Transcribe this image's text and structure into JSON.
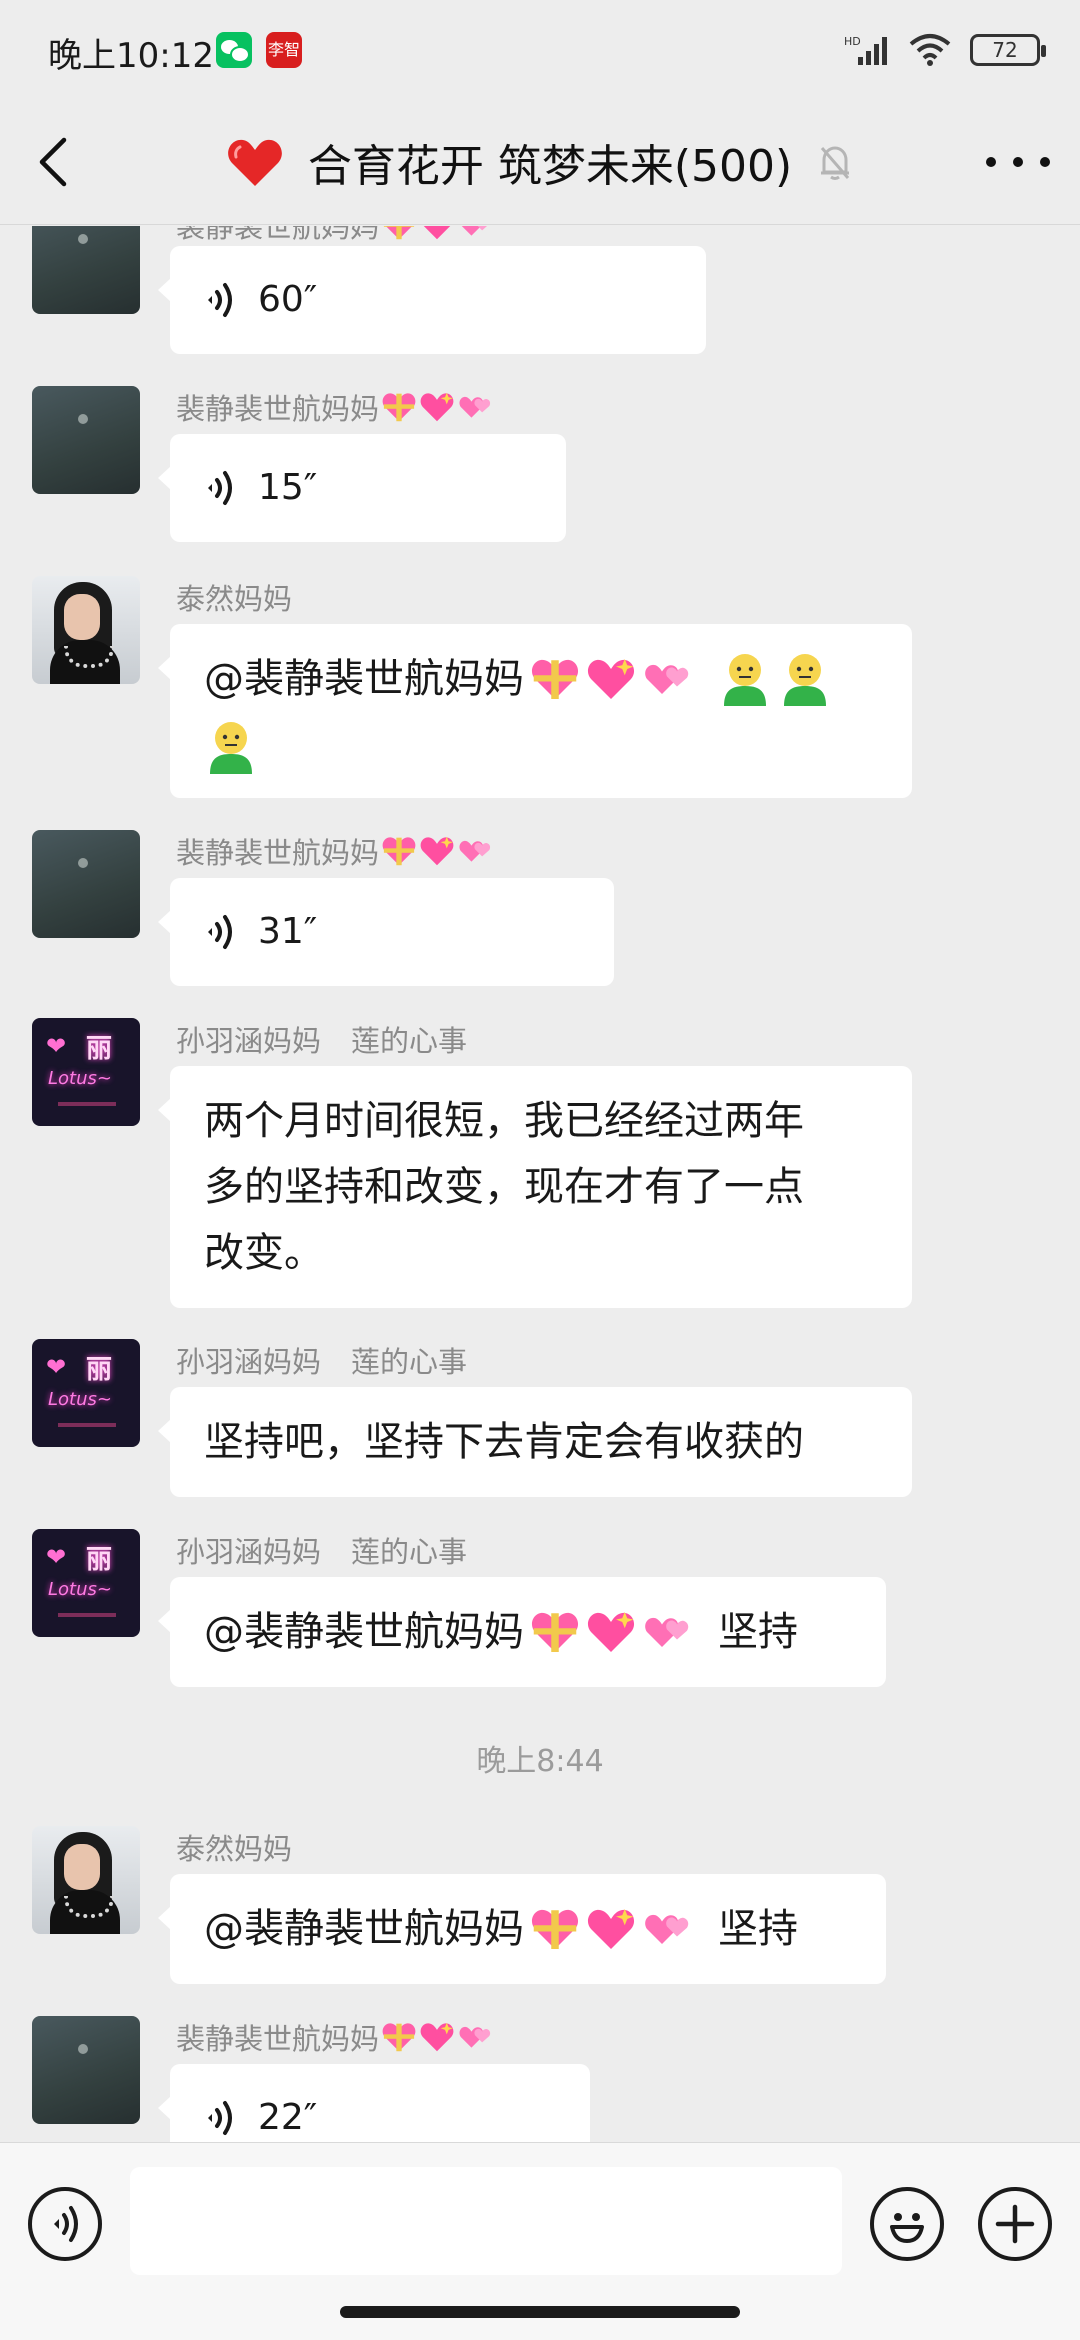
{
  "status_bar": {
    "time": "晚上10:12",
    "app_badge": "李智",
    "network": "HD",
    "battery": "72"
  },
  "header": {
    "title": "合育花开 筑梦未来(500)"
  },
  "messages": [
    {
      "type": "voice",
      "sender": "裴静裴世航妈妈",
      "duration": "60″"
    },
    {
      "type": "voice",
      "sender": "裴静裴世航妈妈",
      "duration": "15″"
    },
    {
      "type": "text",
      "sender": "泰然妈妈",
      "mention": "@裴静裴世航妈妈"
    },
    {
      "type": "voice",
      "sender": "裴静裴世航妈妈",
      "duration": "31″"
    },
    {
      "type": "text",
      "sender": "孙羽涵妈妈",
      "sender_note": "莲的心事",
      "lines": [
        "两个月时间很短，我已经经过两年",
        "多的坚持和改变，现在才有了一点",
        "改变。"
      ]
    },
    {
      "type": "text",
      "sender": "孙羽涵妈妈",
      "sender_note": "莲的心事",
      "text": "坚持吧，坚持下去肯定会有收获的"
    },
    {
      "type": "text",
      "sender": "孙羽涵妈妈",
      "sender_note": "莲的心事",
      "mention": "@裴静裴世航妈妈",
      "suffix": "坚持"
    },
    {
      "type": "time",
      "text": "晚上8:44"
    },
    {
      "type": "text",
      "sender": "泰然妈妈",
      "mention": "@裴静裴世航妈妈",
      "suffix": "坚持"
    },
    {
      "type": "voice",
      "sender": "裴静裴世航妈妈",
      "duration": "22″"
    }
  ],
  "input": {
    "value": ""
  },
  "icons": [
    "back-icon",
    "heart-icon",
    "mute-bell-icon",
    "more-icon",
    "voice-wave-icon",
    "emoji-icon",
    "plus-icon"
  ],
  "colors": {
    "background": "#ededed",
    "bubble": "#ffffff",
    "name": "#8a8a8a"
  }
}
